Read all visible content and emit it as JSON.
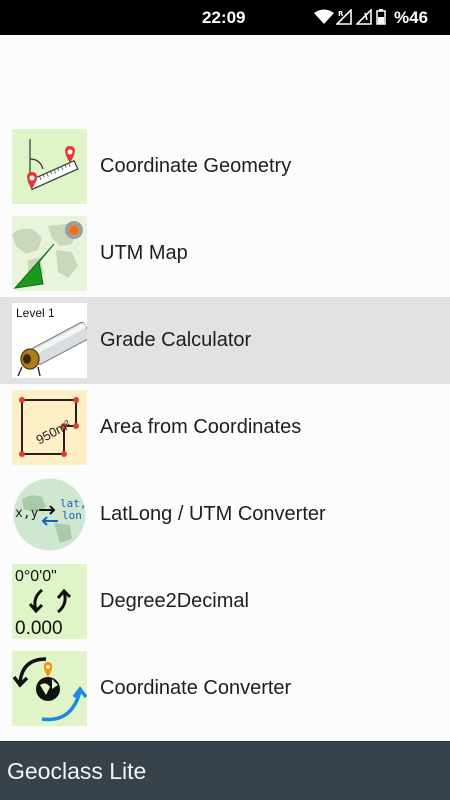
{
  "status_bar": {
    "time": "22:09",
    "battery": "%46",
    "icons": [
      "wifi-icon",
      "signal-r-icon",
      "signal-icon",
      "battery-icon"
    ]
  },
  "menu": {
    "items": [
      {
        "label": "Coordinate Geometry",
        "icon": "coordinate-geometry-icon",
        "selected": false
      },
      {
        "label": "UTM Map",
        "icon": "utm-map-icon",
        "selected": false
      },
      {
        "label": "Grade Calculator",
        "icon": "grade-calculator-icon",
        "selected": true,
        "icon_text": "Level 1"
      },
      {
        "label": "Area from Coordinates",
        "icon": "area-icon",
        "selected": false,
        "icon_text": "950m²"
      },
      {
        "label": "LatLong / UTM Converter",
        "icon": "latlong-utm-icon",
        "selected": false,
        "icon_text_left": "x,y",
        "icon_text_right": [
          "lat,",
          "lon"
        ]
      },
      {
        "label": "Degree2Decimal",
        "icon": "degree-decimal-icon",
        "selected": false,
        "icon_text_top": "0°0'0\"",
        "icon_text_bottom": "0.000"
      },
      {
        "label": "Coordinate Converter",
        "icon": "coordinate-converter-icon",
        "selected": false
      }
    ]
  },
  "footer": {
    "title": "Geoclass Lite"
  },
  "colors": {
    "status_bar": "#000000",
    "footer": "#37424b",
    "selected_row": "#e3e1e3",
    "icon_bg_green": "#dff5c8",
    "icon_bg_yellow": "#fdf0c6"
  }
}
